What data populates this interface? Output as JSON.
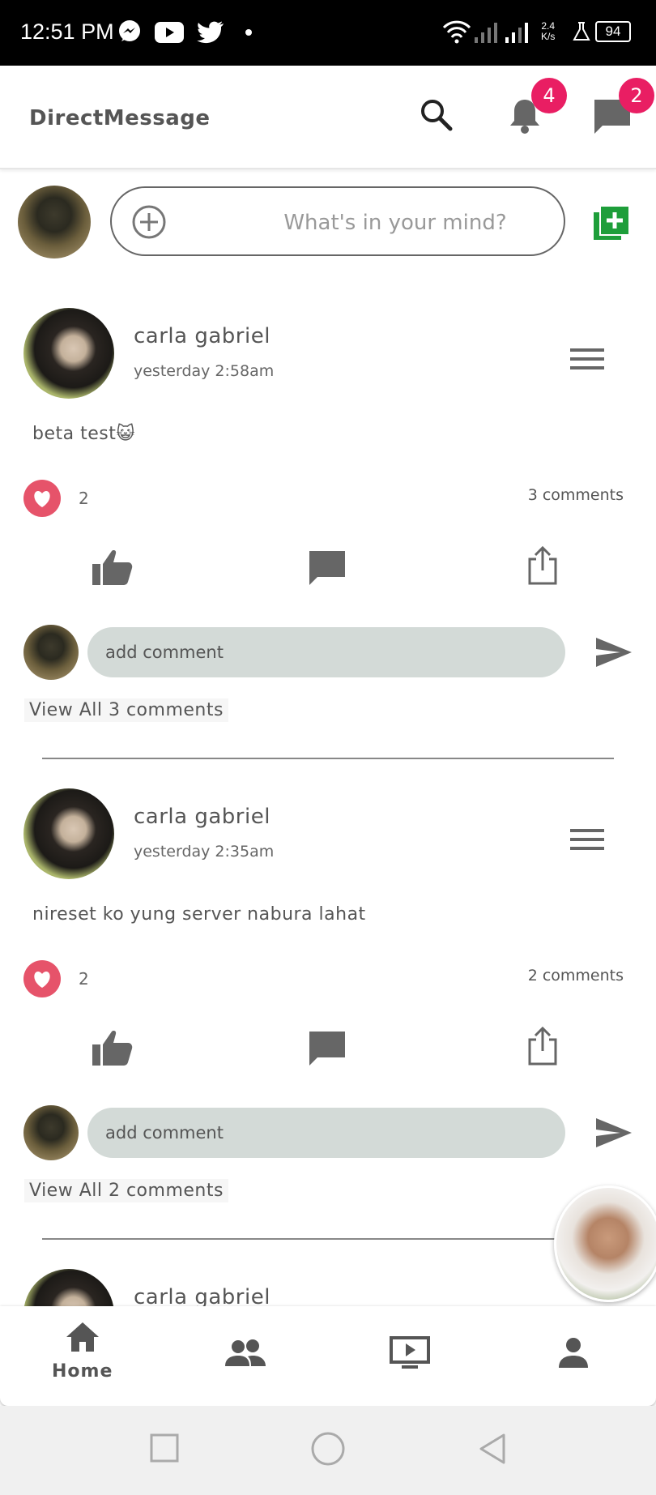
{
  "status_bar": {
    "time": "12:51 PM",
    "net_speed_value": "2.4",
    "net_speed_unit": "K/s",
    "battery": "94",
    "icons": [
      "messenger-icon",
      "youtube-icon",
      "twitter-icon",
      "dot-icon",
      "wifi-icon",
      "signal-icon",
      "signal-icon",
      "lab-icon"
    ]
  },
  "app_bar": {
    "title": "DirectMessage",
    "notifications_badge": "4",
    "messages_badge": "2",
    "icons": [
      "search-icon",
      "bell-icon",
      "chat-icon"
    ]
  },
  "composer": {
    "placeholder": "What's in your mind?",
    "icons": [
      "add-circle-icon",
      "add-photo-icon"
    ]
  },
  "posts": [
    {
      "author": "carla gabriel",
      "time": "yesterday 2:58am",
      "body": "beta test😺",
      "likes": "2",
      "comments": "3 comments",
      "add_comment": "add comment",
      "view_all": "View All 3 comments"
    },
    {
      "author": "carla gabriel",
      "time": "yesterday 2:35am",
      "body": "nireset ko yung server nabura lahat",
      "likes": "2",
      "comments": "2 comments",
      "add_comment": "add comment",
      "view_all": "View All 2 comments"
    },
    {
      "author": "carla gabriel"
    }
  ],
  "bottom_nav": {
    "home_label": "Home",
    "items": [
      "home-icon",
      "friends-icon",
      "video-icon",
      "profile-icon"
    ]
  },
  "colors": {
    "badge": "#e91e63",
    "heart": "#e6536a",
    "add_photo": "#1e9e3a",
    "comment_field": "#d3dad7",
    "icon_gray": "#6f6f6f"
  }
}
